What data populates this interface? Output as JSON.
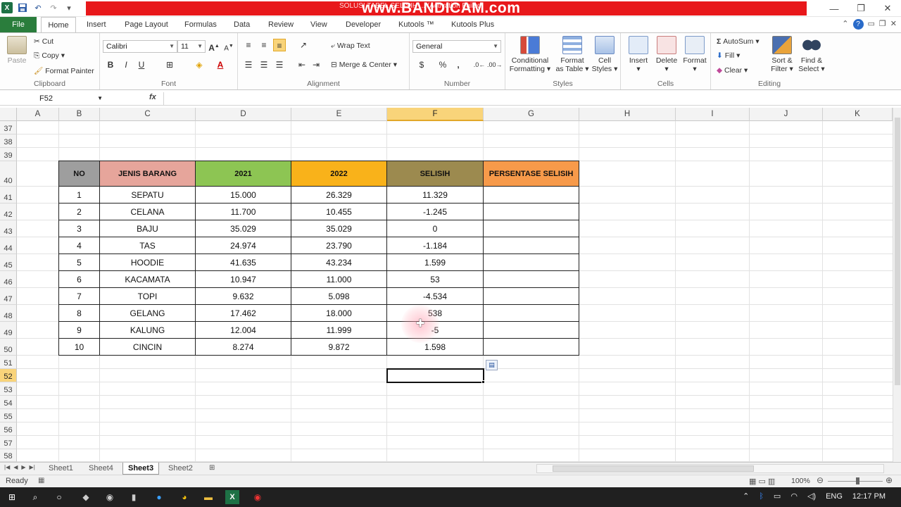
{
  "window": {
    "title": "SOLUSI TABEL SELISIH ... (Activation Failed)",
    "watermark": "www.BANDICAM.com",
    "controls": [
      "—",
      "❐",
      "✕"
    ]
  },
  "ribbon_tabs": [
    "File",
    "Home",
    "Insert",
    "Page Layout",
    "Formulas",
    "Data",
    "Review",
    "View",
    "Developer",
    "Kutools ™",
    "Kutools Plus"
  ],
  "ribbon": {
    "clipboard": {
      "paste": "Paste",
      "cut": "Cut",
      "copy": "Copy",
      "format_painter": "Format Painter",
      "label": "Clipboard"
    },
    "font": {
      "name": "Calibri",
      "size": "11",
      "bold": "B",
      "italic": "I",
      "underline": "U",
      "label": "Font"
    },
    "alignment": {
      "wrap": "Wrap Text",
      "merge": "Merge & Center",
      "label": "Alignment"
    },
    "number": {
      "format": "General",
      "currency": "$",
      "percent": "%",
      "comma": ",",
      "label": "Number"
    },
    "styles": {
      "conditional": "Conditional",
      "conditional2": "Formatting",
      "format_as": "Format",
      "format_as2": "as Table",
      "cell": "Cell",
      "cell2": "Styles",
      "label": "Styles"
    },
    "cells": {
      "insert": "Insert",
      "delete": "Delete",
      "format": "Format",
      "label": "Cells"
    },
    "editing": {
      "autosum": "AutoSum",
      "fill": "Fill",
      "clear": "Clear",
      "sort": "Sort &",
      "sort2": "Filter",
      "find": "Find &",
      "find2": "Select",
      "label": "Editing"
    }
  },
  "formula_bar": {
    "name_box": "F52",
    "fx": "fx",
    "formula": ""
  },
  "columns": [
    "A",
    "B",
    "C",
    "D",
    "E",
    "F",
    "G",
    "H",
    "I",
    "J",
    "K"
  ],
  "rows": [
    "37",
    "38",
    "39",
    "40",
    "41",
    "42",
    "43",
    "44",
    "45",
    "46",
    "47",
    "48",
    "49",
    "50",
    "51",
    "52",
    "53",
    "54",
    "55",
    "56",
    "57",
    "58"
  ],
  "table": {
    "headers": [
      "NO",
      "JENIS BARANG",
      "2021",
      "2022",
      "SELISIH",
      "PERSENTASE SELISIH"
    ],
    "header_colors": [
      "#9e9e9e",
      "#e6a59b",
      "#8dc553",
      "#f9b21a",
      "#9c8a4f",
      "#f79a4a"
    ],
    "rows": [
      [
        "1",
        "SEPATU",
        "15.000",
        "26.329",
        "11.329",
        ""
      ],
      [
        "2",
        "CELANA",
        "11.700",
        "10.455",
        "-1.245",
        ""
      ],
      [
        "3",
        "BAJU",
        "35.029",
        "35.029",
        "0",
        ""
      ],
      [
        "4",
        "TAS",
        "24.974",
        "23.790",
        "-1.184",
        ""
      ],
      [
        "5",
        "HOODIE",
        "41.635",
        "43.234",
        "1.599",
        ""
      ],
      [
        "6",
        "KACAMATA",
        "10.947",
        "11.000",
        "53",
        ""
      ],
      [
        "7",
        "TOPI",
        "9.632",
        "5.098",
        "-4.534",
        ""
      ],
      [
        "8",
        "GELANG",
        "17.462",
        "18.000",
        "538",
        ""
      ],
      [
        "9",
        "KALUNG",
        "12.004",
        "11.999",
        "-5",
        ""
      ],
      [
        "10",
        "CINCIN",
        "8.274",
        "9.872",
        "1.598",
        ""
      ]
    ]
  },
  "sheets": [
    "Sheet1",
    "Sheet4",
    "Sheet3",
    "Sheet2"
  ],
  "active_sheet": "Sheet3",
  "status": {
    "ready": "Ready",
    "zoom": "100%"
  },
  "taskbar": {
    "lang": "ENG",
    "time": "12:17 PM"
  }
}
